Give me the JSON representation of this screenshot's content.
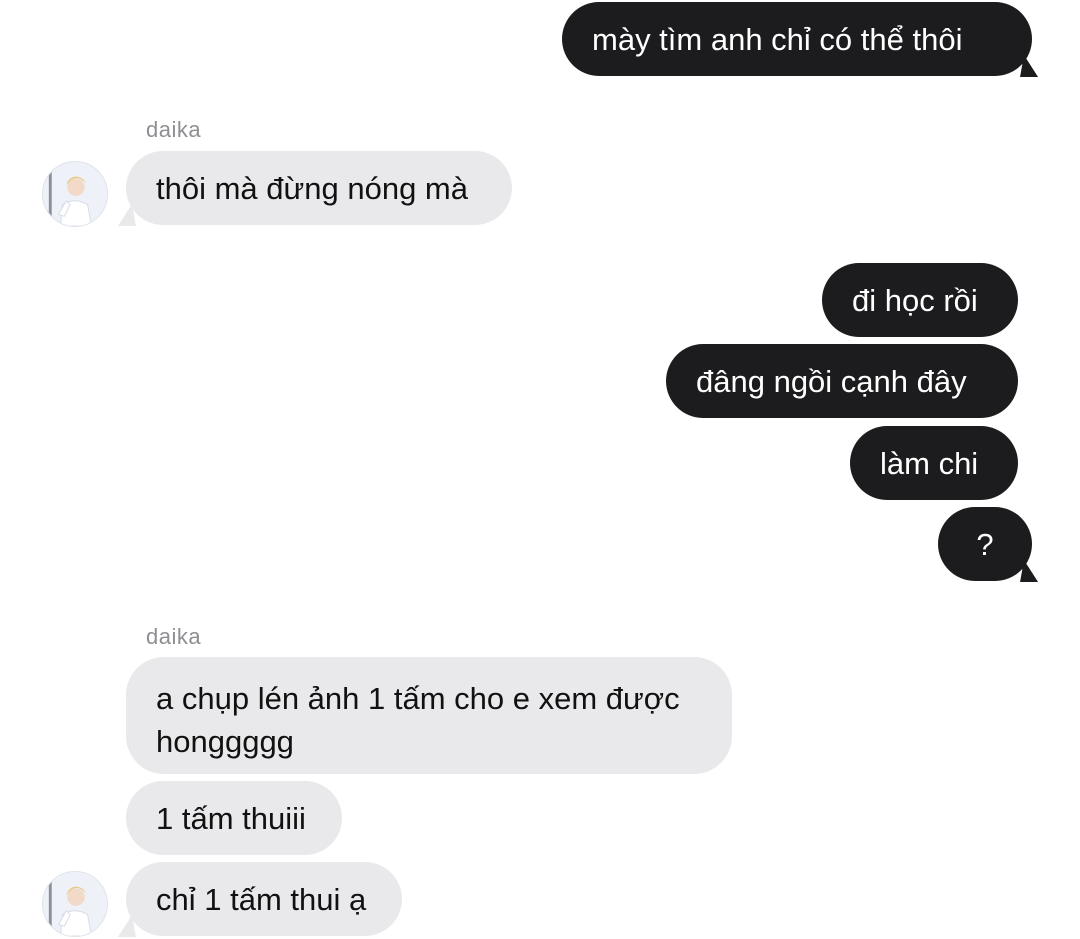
{
  "conversation": {
    "messages": [
      {
        "id": "m1",
        "direction": "outgoing",
        "text": "mày tìm anh chỉ có thể thôi"
      },
      {
        "id": "m2",
        "direction": "incoming",
        "sender": "daika",
        "text": "thôi mà đừng nóng mà"
      },
      {
        "id": "m3",
        "direction": "outgoing",
        "text": "đi học rồi"
      },
      {
        "id": "m4",
        "direction": "outgoing",
        "text": "đâng ngồi cạnh đây"
      },
      {
        "id": "m5",
        "direction": "outgoing",
        "text": "làm chi"
      },
      {
        "id": "m6",
        "direction": "outgoing",
        "text": "?"
      },
      {
        "id": "m7",
        "direction": "incoming",
        "sender": "daika",
        "text": "a chụp lén ảnh 1 tấm cho e xem được honggggg"
      },
      {
        "id": "m8",
        "direction": "incoming",
        "sender": "daika",
        "text": "1 tấm thuiii"
      },
      {
        "id": "m9",
        "direction": "incoming",
        "sender": "daika",
        "text": "chỉ 1 tấm thui ạ"
      }
    ],
    "sender_labels": [
      "daika",
      "daika"
    ],
    "avatar_icon": "contact-avatar-photo"
  },
  "colors": {
    "background": "#ffffff",
    "outgoing_bubble": "#1c1c1e",
    "outgoing_text": "#ffffff",
    "incoming_bubble": "#e9e9eb",
    "incoming_text": "#111111",
    "sender_label": "#8e8e93"
  }
}
